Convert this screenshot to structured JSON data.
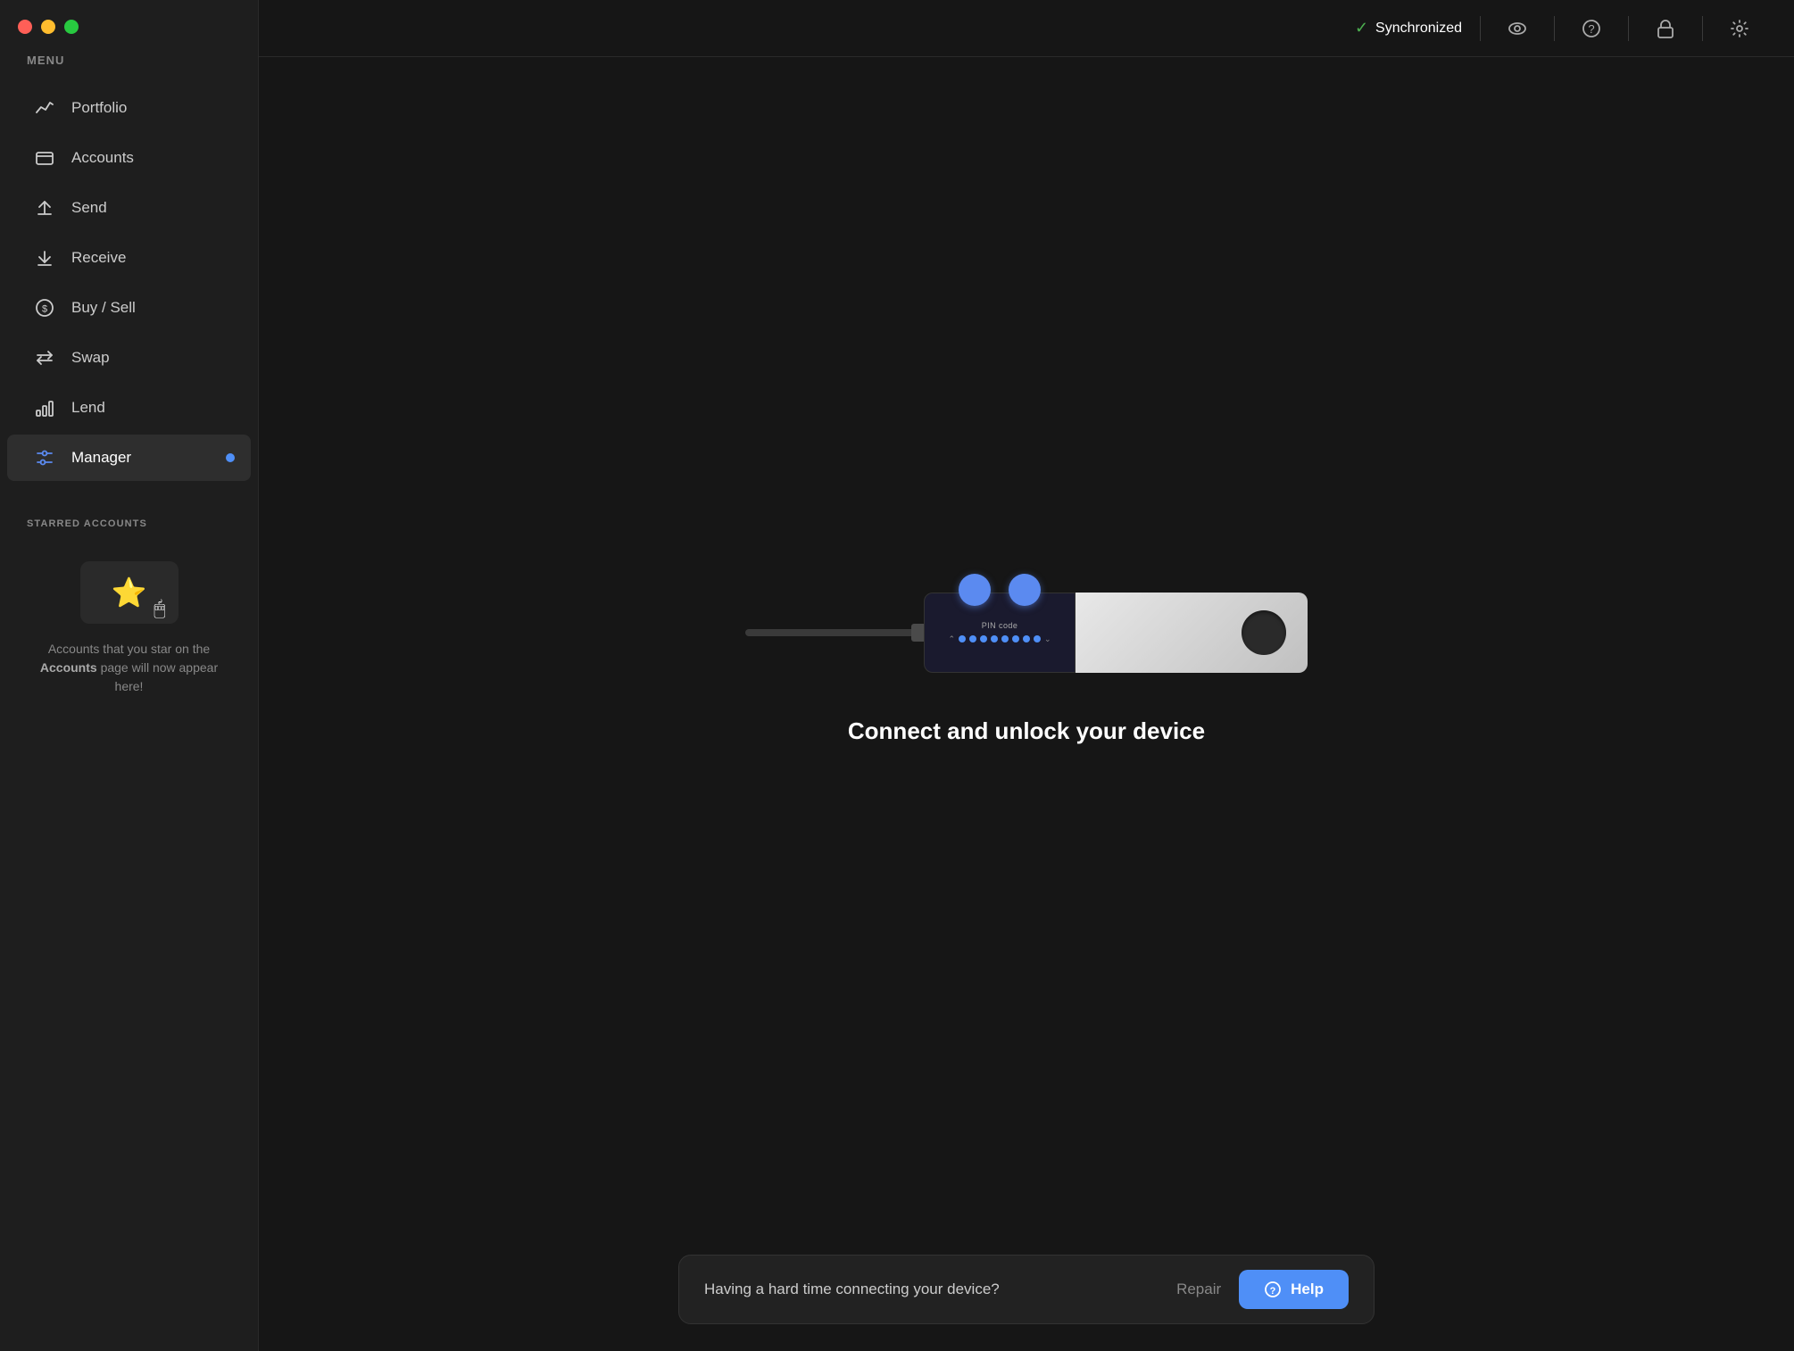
{
  "trafficLights": {
    "colors": [
      "#ff5f57",
      "#ffbd2e",
      "#28c940"
    ]
  },
  "sidebar": {
    "menuLabel": "MENU",
    "items": [
      {
        "id": "portfolio",
        "label": "Portfolio",
        "active": false
      },
      {
        "id": "accounts",
        "label": "Accounts",
        "active": false
      },
      {
        "id": "send",
        "label": "Send",
        "active": false
      },
      {
        "id": "receive",
        "label": "Receive",
        "active": false
      },
      {
        "id": "buy-sell",
        "label": "Buy / Sell",
        "active": false
      },
      {
        "id": "swap",
        "label": "Swap",
        "active": false
      },
      {
        "id": "lend",
        "label": "Lend",
        "active": false
      },
      {
        "id": "manager",
        "label": "Manager",
        "active": true,
        "badge": true
      }
    ],
    "starredLabel": "STARRED ACCOUNTS",
    "starredText1": "Accounts that you star on the ",
    "starredTextBold": "Accounts",
    "starredText2": " page will now appear here!"
  },
  "header": {
    "syncLabel": "Synchronized",
    "syncStatus": "synced"
  },
  "main": {
    "connectTitle": "Connect and unlock your device",
    "pinCodeLabel": "PIN code",
    "bottomBar": {
      "helpText": "Having a hard time connecting your device?",
      "repairLabel": "Repair",
      "helpLabel": "Help"
    }
  }
}
